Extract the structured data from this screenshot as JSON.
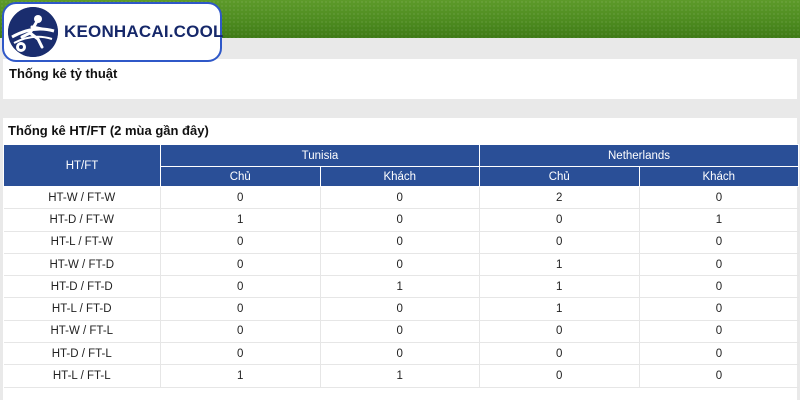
{
  "site": {
    "logo_text": "KEONHACAI.COOL"
  },
  "section1": {
    "title": "Thống kê tỷ thuật"
  },
  "section2": {
    "title": "Thống kê HT/FT (2 mùa gần đây)",
    "header": {
      "first_col": "HT/FT",
      "team1": "Tunisia",
      "team2": "Netherlands",
      "home": "Chủ",
      "away": "Khách"
    },
    "rows": [
      {
        "label": "HT-W / FT-W",
        "t1_home": "0",
        "t1_away": "0",
        "t2_home": "2",
        "t2_away": "0"
      },
      {
        "label": "HT-D / FT-W",
        "t1_home": "1",
        "t1_away": "0",
        "t2_home": "0",
        "t2_away": "1"
      },
      {
        "label": "HT-L / FT-W",
        "t1_home": "0",
        "t1_away": "0",
        "t2_home": "0",
        "t2_away": "0"
      },
      {
        "label": "HT-W / FT-D",
        "t1_home": "0",
        "t1_away": "0",
        "t2_home": "1",
        "t2_away": "0"
      },
      {
        "label": "HT-D / FT-D",
        "t1_home": "0",
        "t1_away": "1",
        "t2_home": "1",
        "t2_away": "0"
      },
      {
        "label": "HT-L / FT-D",
        "t1_home": "0",
        "t1_away": "0",
        "t2_home": "1",
        "t2_away": "0"
      },
      {
        "label": "HT-W / FT-L",
        "t1_home": "0",
        "t1_away": "0",
        "t2_home": "0",
        "t2_away": "0"
      },
      {
        "label": "HT-D / FT-L",
        "t1_home": "0",
        "t1_away": "0",
        "t2_home": "0",
        "t2_away": "0"
      },
      {
        "label": "HT-L / FT-L",
        "t1_home": "1",
        "t1_away": "1",
        "t2_home": "0",
        "t2_away": "0"
      }
    ]
  },
  "colors": {
    "header_bg": "#2a4f97",
    "logo_border": "#2f58c8",
    "banner_green": "#4c8a1f"
  },
  "icons": {
    "logo": "soccer-player-ball-icon"
  }
}
